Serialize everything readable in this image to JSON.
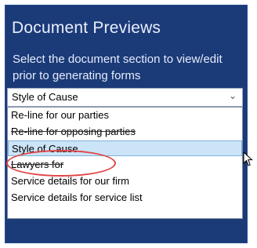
{
  "panel": {
    "title": "Document Previews",
    "instruction": "Select the document section to view/edit prior to generating forms"
  },
  "dropdown": {
    "selected_value": "Style of Cause",
    "options": [
      "Re-line for our parties",
      "Re-line for opposing parties",
      "Style of Cause",
      "Lawyers for",
      "Service details for our firm",
      "Service details for service list"
    ]
  },
  "colors": {
    "panel_background": "#1b3a78",
    "highlight_ring": "#e04545",
    "selected_option": "#cce4f7"
  }
}
